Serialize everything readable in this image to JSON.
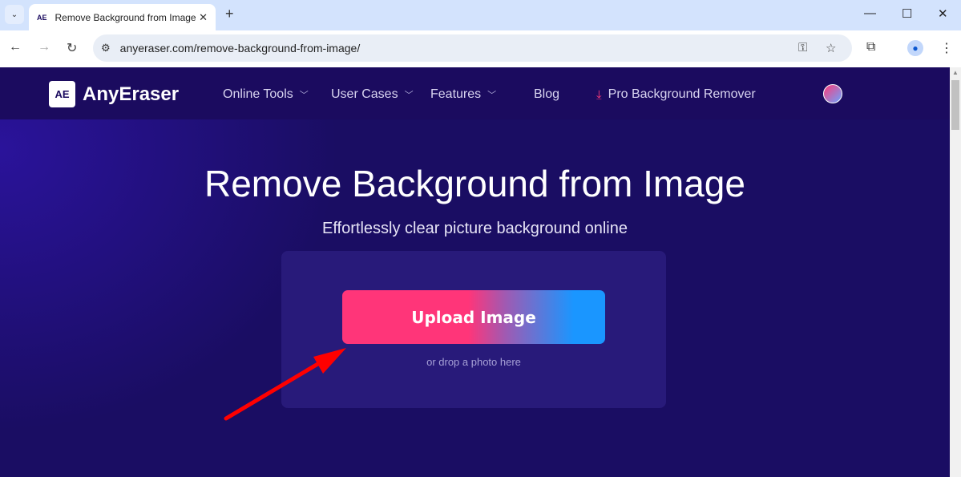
{
  "browser": {
    "tab_title": "Remove Background from Image",
    "tab_favicon": "AE",
    "url": "anyeraser.com/remove-background-from-image/"
  },
  "site": {
    "logo_mark": "AE",
    "logo_name": "AnyEraser",
    "nav": [
      {
        "label": "Online Tools"
      },
      {
        "label": "User Cases"
      },
      {
        "label": "Features"
      },
      {
        "label": "Blog"
      },
      {
        "label": "Pro Background Remover"
      }
    ]
  },
  "hero": {
    "title": "Remove Background from Image",
    "subtitle": "Effortlessly clear picture background online",
    "upload_label": "Upload Image",
    "drop_hint": "or drop a photo here"
  },
  "colors": {
    "bg": "#1a0d63",
    "header": "#1b0b5f",
    "card": "#281a7a",
    "accent_pink": "#ff3579",
    "accent_blue": "#1a96ff",
    "annotation_arrow": "#ff0000"
  }
}
